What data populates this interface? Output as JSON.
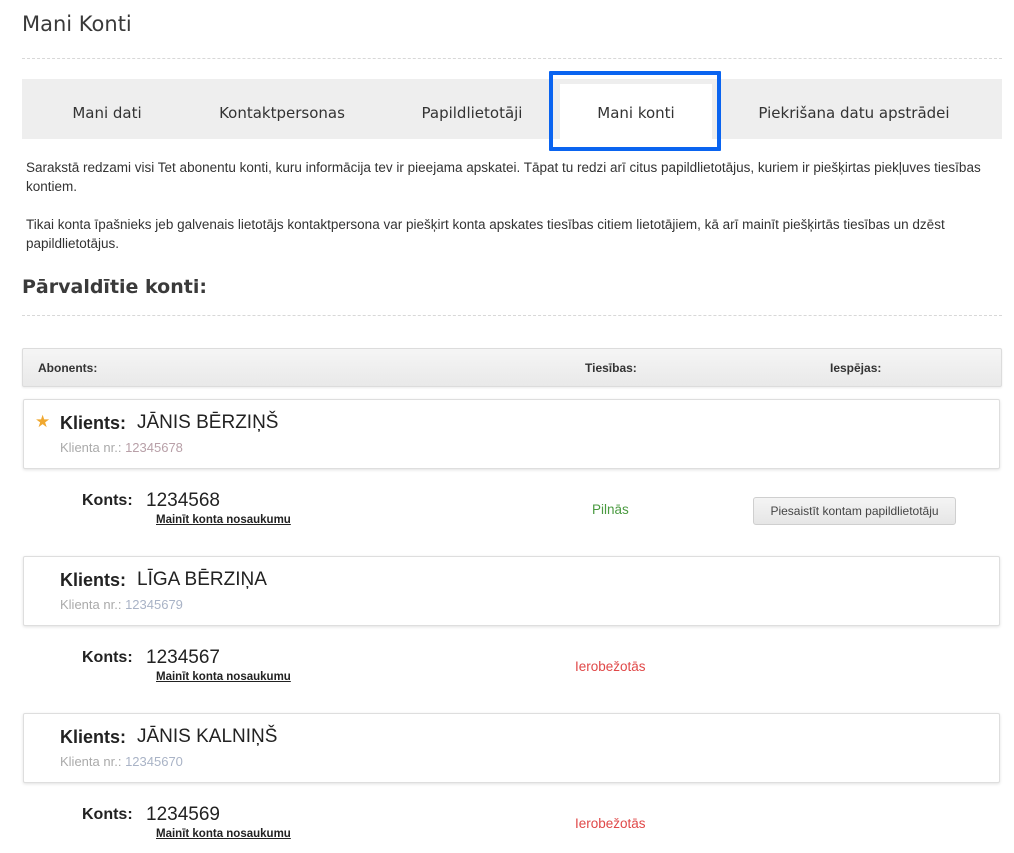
{
  "page": {
    "title": "Mani Konti"
  },
  "tabs": [
    {
      "label": "Mani dati"
    },
    {
      "label": "Kontaktpersonas"
    },
    {
      "label": "Papildlietotāji"
    },
    {
      "label": "Mani konti"
    },
    {
      "label": "Piekrišana datu apstrādei"
    }
  ],
  "info": {
    "p1": "Sarakstā redzami visi Tet abonentu konti, kuru informācija tev ir pieejama apskatei. Tāpat tu redzi arī citus papildlietotājus, kuriem ir piešķirtas piekļuves tiesības kontiem.",
    "p2": "Tikai konta īpašnieks jeb galvenais lietotājs kontaktpersona var piešķirt konta apskates tiesības citiem lietotājiem, kā arī mainīt piešķirtās tiesības un dzēst papildlietotājus."
  },
  "section": {
    "title": "Pārvaldītie konti:"
  },
  "table": {
    "col_subscriber": "Abonents:",
    "col_rights": "Tiesības:",
    "col_options": "Iespējas:"
  },
  "labels": {
    "client": "Klients:",
    "client_nr": "Klienta nr.:",
    "account": "Konts:",
    "rename": "Mainīt konta nosaukumu"
  },
  "clients": [
    {
      "name": "JĀNIS BĒRZIŅŠ",
      "nr": "12345678",
      "account": "1234568",
      "rights": "Pilnās",
      "action": "Piesaistīt kontam papildlietotāju"
    },
    {
      "name": "LĪGA BĒRZIŅA",
      "nr": "12345679",
      "account": "1234567",
      "rights": "Ierobežotās"
    },
    {
      "name": "JĀNIS KALNIŅŠ",
      "nr": "12345670",
      "account": "1234569",
      "rights": "Ierobežotās"
    }
  ],
  "colors": {
    "accent": "#0a64f0",
    "star": "#f0a830",
    "full": "#4a9a40",
    "limited": "#e04848"
  }
}
